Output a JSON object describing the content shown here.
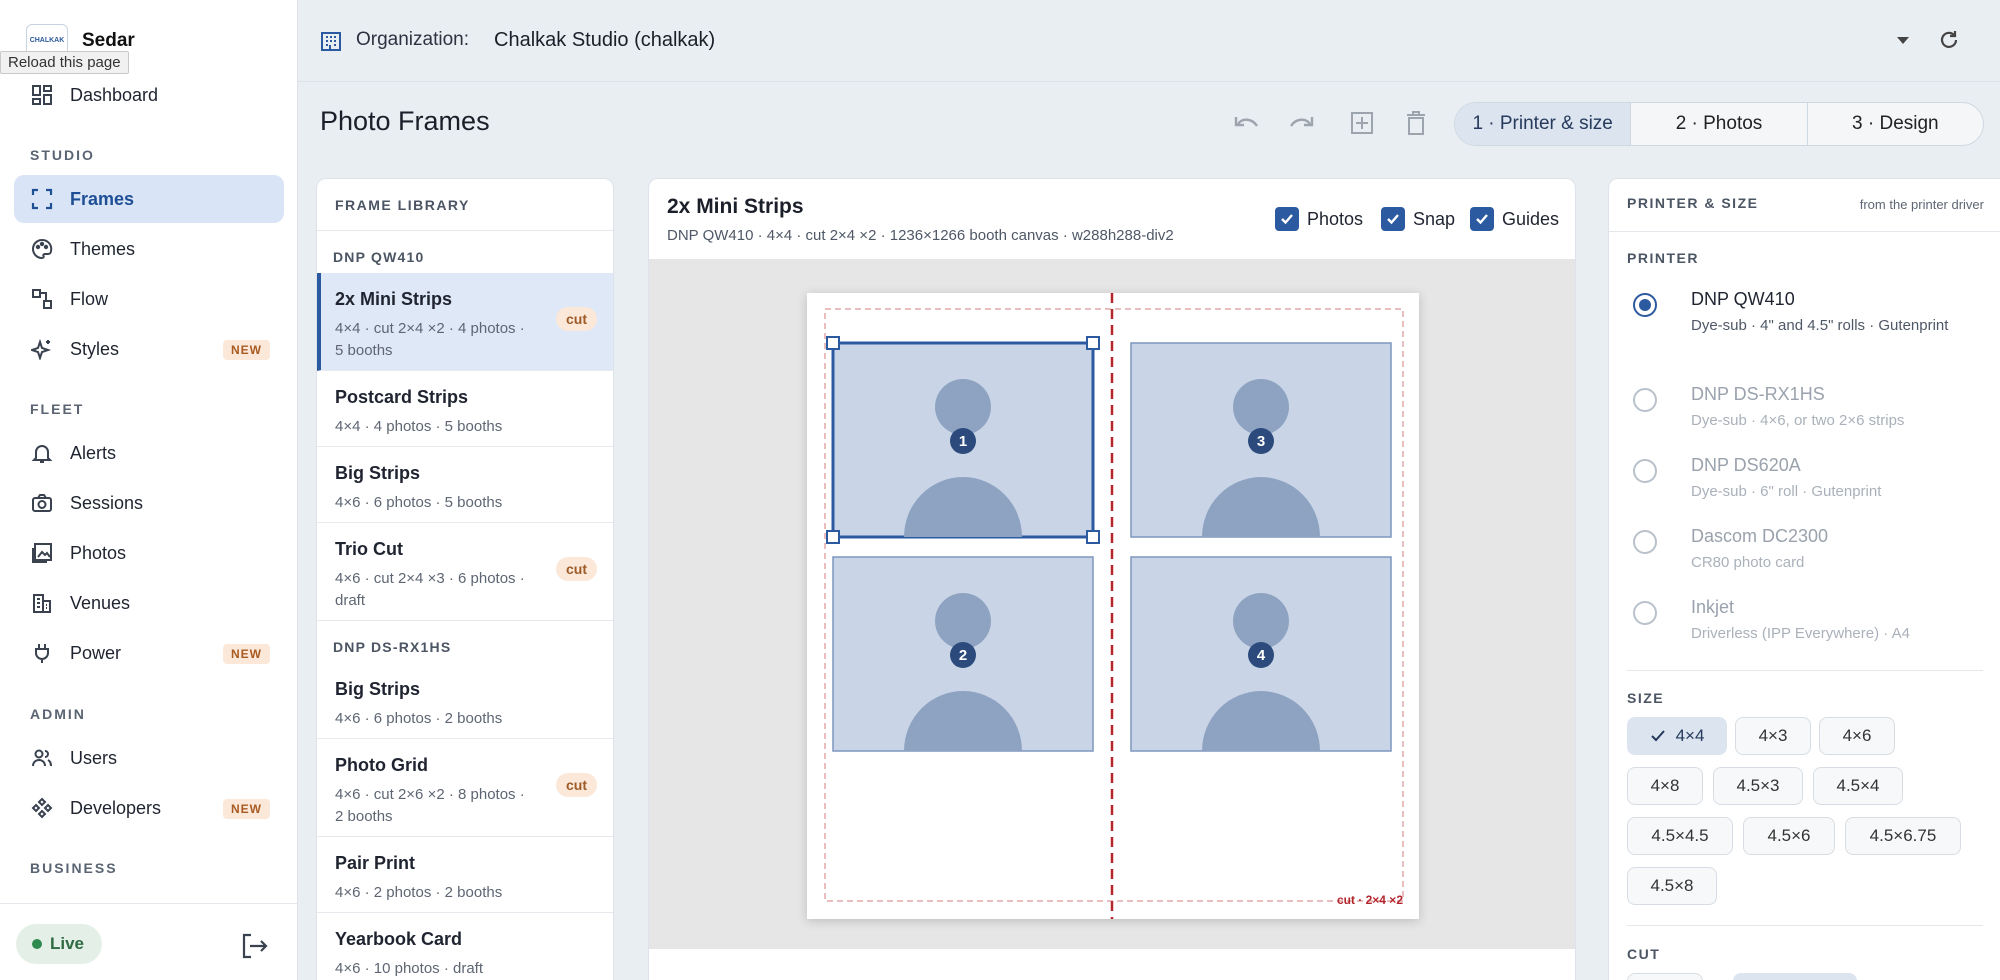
{
  "sidebar": {
    "brand": "Sedar",
    "logo_text": "CHALKAK",
    "tooltip": "Reload this page",
    "dashboard": "Dashboard",
    "sections": {
      "studio": "STUDIO",
      "fleet": "FLEET",
      "admin": "ADMIN",
      "business": "BUSINESS"
    },
    "items": {
      "frames": "Frames",
      "themes": "Themes",
      "flow": "Flow",
      "styles": "Styles",
      "alerts": "Alerts",
      "sessions": "Sessions",
      "photos": "Photos",
      "venues": "Venues",
      "power": "Power",
      "users": "Users",
      "developers": "Developers"
    },
    "new_badge": "NEW",
    "live": "Live"
  },
  "topbar": {
    "org_label": "Organization:",
    "org_value": "Chalkak Studio (chalkak)"
  },
  "header": {
    "title": "Photo Frames",
    "steps": [
      "1 · Printer & size",
      "2 · Photos",
      "3 · Design"
    ]
  },
  "library": {
    "heading": "FRAME LIBRARY",
    "groups": [
      "DNP QW410",
      "DNP DS-RX1HS"
    ],
    "items": [
      {
        "name": "2x Mini Strips",
        "meta": "4×4 · cut 2×4 ×2 · 4 photos · 5 booths",
        "badge": "cut"
      },
      {
        "name": "Postcard Strips",
        "meta": "4×4 · 4 photos · 5 booths",
        "badge": ""
      },
      {
        "name": "Big Strips",
        "meta": "4×6 · 6 photos · 5 booths",
        "badge": ""
      },
      {
        "name": "Trio Cut",
        "meta": "4×6 · cut 2×4 ×3 · 6 photos · draft",
        "badge": "cut"
      },
      {
        "name": "Big Strips",
        "meta": "4×6 · 6 photos · 2 booths",
        "badge": ""
      },
      {
        "name": "Photo Grid",
        "meta": "4×6 · cut 2×6 ×2 · 8 photos · 2 booths",
        "badge": "cut"
      },
      {
        "name": "Pair Print",
        "meta": "4×6 · 2 photos · 2 booths",
        "badge": ""
      },
      {
        "name": "Yearbook Card",
        "meta": "4×6 · 10 photos · draft",
        "badge": ""
      }
    ]
  },
  "canvas": {
    "title": "2x Mini Strips",
    "subtitle": "DNP QW410 · 4×4 · cut 2×4 ×2 · 1236×1266 booth canvas · w288h288-div2",
    "toggles": {
      "photos": "Photos",
      "snap": "Snap",
      "guides": "Guides"
    },
    "slot_numbers": [
      "1",
      "2",
      "3",
      "4"
    ],
    "cut_label": "cut · 2×4 ×2"
  },
  "printer_panel": {
    "heading": "PRINTER & SIZE",
    "note": "from the printer driver",
    "printer_label": "PRINTER",
    "printers": [
      {
        "name": "DNP QW410",
        "desc": "Dye-sub · 4\" and 4.5\" rolls · Gutenprint",
        "selected": true
      },
      {
        "name": "DNP DS-RX1HS",
        "desc": "Dye-sub · 4×6, or two 2×6 strips",
        "selected": false
      },
      {
        "name": "DNP DS620A",
        "desc": "Dye-sub · 6\" roll · Gutenprint",
        "selected": false
      },
      {
        "name": "Dascom DC2300",
        "desc": "CR80 photo card",
        "selected": false
      },
      {
        "name": "Inkjet",
        "desc": "Driverless (IPP Everywhere) · A4",
        "selected": false
      }
    ],
    "size_label": "SIZE",
    "sizes": [
      "4×4",
      "4×3",
      "4×6",
      "4×8",
      "4.5×3",
      "4.5×4",
      "4.5×4.5",
      "4.5×6",
      "4.5×6.75",
      "4.5×8"
    ],
    "selected_size": "4×4",
    "cut_label": "CUT"
  },
  "colors": {
    "accent": "#2c5aa0",
    "slot_fill": "#c9d5e6",
    "cut_line": "#b3262c",
    "badge_bg": "#fbe8d9"
  }
}
